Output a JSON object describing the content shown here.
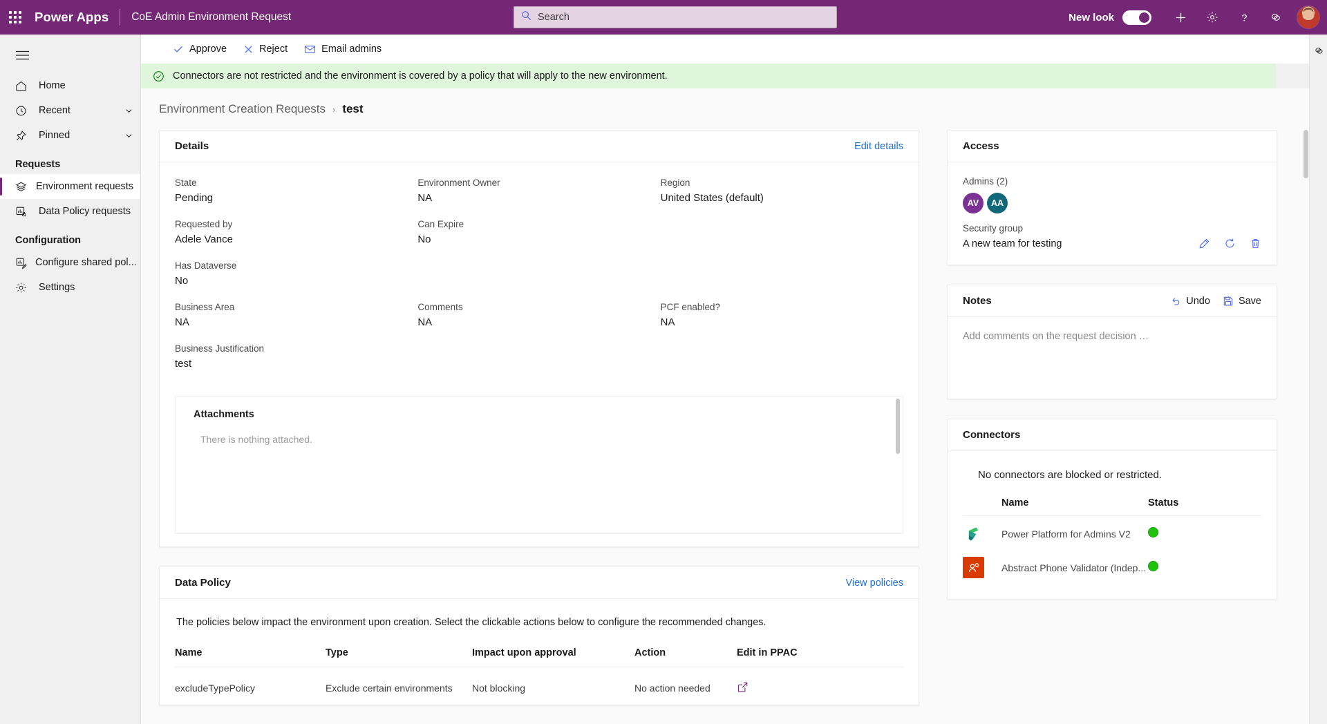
{
  "topbar": {
    "waffle_label": "app-launcher",
    "brand": "Power Apps",
    "app_name": "CoE Admin Environment Request",
    "search_placeholder": "Search",
    "new_look_label": "New look",
    "new_look_on": true,
    "brand_color": "#742774"
  },
  "leftnav": {
    "items": [
      {
        "label": "Home",
        "icon": "home-icon",
        "chevron": false,
        "selected": false
      },
      {
        "label": "Recent",
        "icon": "clock-icon",
        "chevron": true,
        "selected": false
      },
      {
        "label": "Pinned",
        "icon": "pin-icon",
        "chevron": true,
        "selected": false
      }
    ],
    "section_requests": "Requests",
    "requests": [
      {
        "label": "Environment requests",
        "icon": "layers-icon",
        "selected": true
      },
      {
        "label": "Data Policy requests",
        "icon": "chart-lock-icon",
        "selected": false
      }
    ],
    "section_configuration": "Configuration",
    "configuration": [
      {
        "label": "Configure shared pol...",
        "icon": "policy-edit-icon",
        "selected": false
      },
      {
        "label": "Settings",
        "icon": "gear-icon",
        "selected": false
      }
    ]
  },
  "commandbar": {
    "approve": "Approve",
    "reject": "Reject",
    "email_admins": "Email admins"
  },
  "message": {
    "text": "Connectors are not restricted and the environment is covered by a policy that will apply to the new environment.",
    "color": "#dff6dd",
    "icon_color": "#107c10"
  },
  "breadcrumb": {
    "parent": "Environment Creation Requests",
    "separator": "›",
    "current": "test"
  },
  "details": {
    "title": "Details",
    "edit_link": "Edit details",
    "fields": [
      [
        {
          "label": "State",
          "value": "Pending"
        },
        {
          "label": "Environment Owner",
          "value": "NA"
        },
        {
          "label": "Region",
          "value": "United States (default)"
        }
      ],
      [
        {
          "label": "Requested by",
          "value": "Adele Vance"
        },
        {
          "label": "Can Expire",
          "value": "No"
        },
        {
          "label": "",
          "value": ""
        }
      ],
      [
        {
          "label": "Has Dataverse",
          "value": "No"
        },
        {
          "label": "",
          "value": ""
        },
        {
          "label": "",
          "value": ""
        }
      ],
      [
        {
          "label": "Business Area",
          "value": "NA"
        },
        {
          "label": "Comments",
          "value": "NA"
        },
        {
          "label": "PCF enabled?",
          "value": "NA"
        }
      ],
      [
        {
          "label": "Business Justification",
          "value": "test"
        },
        {
          "label": "",
          "value": ""
        },
        {
          "label": "",
          "value": ""
        }
      ]
    ],
    "attachments_title": "Attachments",
    "attachments_empty": "There is nothing attached."
  },
  "data_policy": {
    "title": "Data Policy",
    "view_link": "View policies",
    "intro": "The policies below impact the environment upon creation. Select the clickable actions below to configure the recommended changes.",
    "columns": [
      "Name",
      "Type",
      "Impact upon approval",
      "Action",
      "Edit in PPAC"
    ],
    "rows": [
      {
        "name": "excludeTypePolicy",
        "type": "Exclude certain environments",
        "impact": "Not blocking",
        "action": "No action needed",
        "edit_icon": "open-in-new-icon"
      }
    ]
  },
  "access": {
    "title": "Access",
    "admins_label": "Admins (2)",
    "admins": [
      {
        "initials": "AV",
        "color": "#7b3294"
      },
      {
        "initials": "AA",
        "color": "#11687a"
      }
    ],
    "security_group_label": "Security group",
    "security_group_value": "A new team for testing",
    "icons": [
      "edit-pencil-icon",
      "refresh-icon",
      "delete-trash-icon"
    ]
  },
  "notes": {
    "title": "Notes",
    "undo_label": "Undo",
    "save_label": "Save",
    "placeholder": "Add comments on the request decision …"
  },
  "connectors": {
    "title": "Connectors",
    "none_text": "No connectors are blocked or restricted.",
    "columns": [
      "Name",
      "Status"
    ],
    "rows": [
      {
        "name": "Power Platform for Admins V2",
        "status_color": "#20c20e",
        "icon": "power-platform-icon"
      },
      {
        "name": "Abstract Phone Validator (Indep...",
        "status_color": "#20c20e",
        "icon": "abstract-phone-validator-icon"
      }
    ]
  },
  "rightrail": {
    "icon": "copilot-icon"
  }
}
